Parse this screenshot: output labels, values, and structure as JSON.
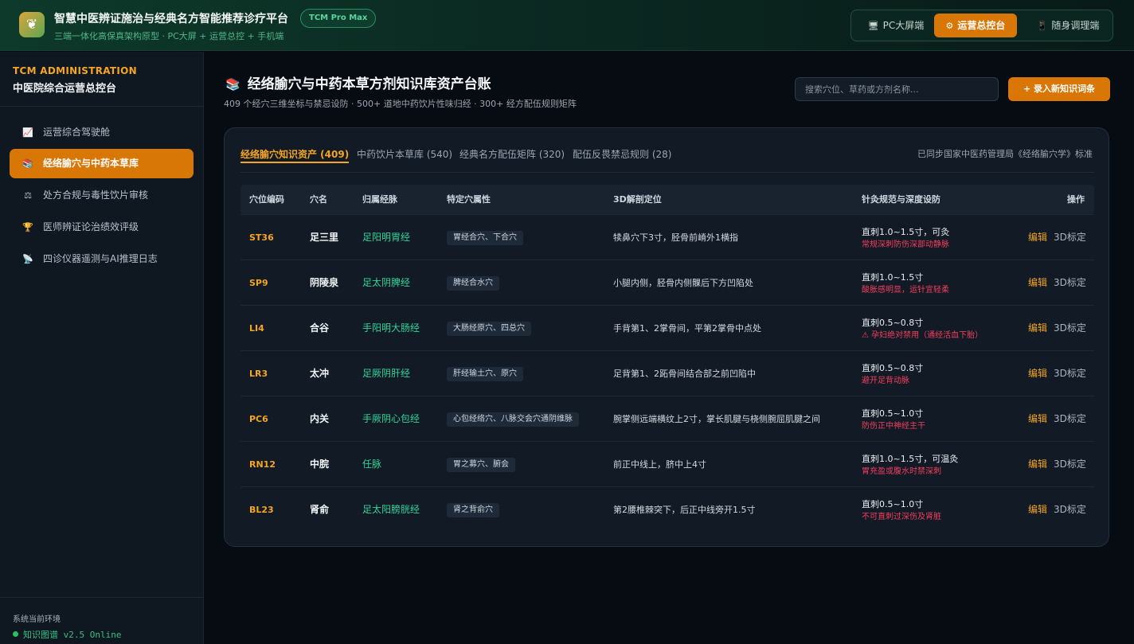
{
  "header": {
    "logo_icon": "leaf-icon",
    "title": "智慧中医辨证施治与经典名方智能推荐诊疗平台",
    "badge": "TCM Pro Max",
    "subtitle": "三端一体化高保真架构原型 · PC大屏 + 运营总控 + 手机端",
    "modes": [
      {
        "icon": "🖥",
        "label": "PC大屏端",
        "active": false
      },
      {
        "icon": "⚙",
        "label": "运营总控台",
        "active": true
      },
      {
        "icon": "📱",
        "label": "随身调理端",
        "active": false
      }
    ]
  },
  "sidebar": {
    "title_en": "TCM ADMINISTRATION",
    "title_cn": "中医院综合运营总控台",
    "items": [
      {
        "icon": "📈",
        "label": "运营综合驾驶舱",
        "active": false
      },
      {
        "icon": "📚",
        "label": "经络腧穴与中药本草库",
        "active": true
      },
      {
        "icon": "⚖",
        "label": "处方合规与毒性饮片审核",
        "active": false
      },
      {
        "icon": "🏆",
        "label": "医师辨证论治绩效评级",
        "active": false
      },
      {
        "icon": "📡",
        "label": "四诊仪器遥测与AI推理日志",
        "active": false
      }
    ],
    "env_label": "系统当前环境",
    "env_status": "知识图谱 v2.5 Online"
  },
  "main": {
    "title_icon": "📚",
    "title": "经络腧穴与中药本草方剂知识库资产台账",
    "subtitle": "409 个经穴三维坐标与禁忌设防 · 500+ 道地中药饮片性味归经 · 300+ 经方配伍规则矩阵",
    "search_placeholder": "搜索穴位、草药或方剂名称...",
    "add_button": "+ 录入新知识词条",
    "tabs": [
      {
        "label": "经络腧穴知识资产 (409)",
        "active": true
      },
      {
        "label": "中药饮片本草库 (540)",
        "active": false
      },
      {
        "label": "经典名方配伍矩阵 (320)",
        "active": false
      },
      {
        "label": "配伍反畏禁忌规则 (28)",
        "active": false
      }
    ],
    "sync_note": "已同步国家中医药管理局《经络腧穴学》标准",
    "columns": [
      "穴位编码",
      "穴名",
      "归属经脉",
      "特定穴属性",
      "3D解剖定位",
      "针灸规范与深度设防",
      "操作"
    ],
    "rows": [
      {
        "code": "ST36",
        "name": "足三里",
        "meridian": "足阳明胃经",
        "attr": "胃经合穴、下合穴",
        "location": "犊鼻穴下3寸，胫骨前嵴外1横指",
        "spec": "直刺1.0~1.5寸，可灸",
        "warning": "常规深刺防伤深部动静脉",
        "edit": "编辑",
        "calib": "3D标定"
      },
      {
        "code": "SP9",
        "name": "阴陵泉",
        "meridian": "足太阴脾经",
        "attr": "脾经合水穴",
        "location": "小腿内侧，胫骨内侧髁后下方凹陷处",
        "spec": "直刺1.0~1.5寸",
        "warning": "酸胀感明显，运针宜轻柔",
        "edit": "编辑",
        "calib": "3D标定"
      },
      {
        "code": "LI4",
        "name": "合谷",
        "meridian": "手阳明大肠经",
        "attr": "大肠经原穴、四总穴",
        "location": "手背第1、2掌骨间，平第2掌骨中点处",
        "spec": "直刺0.5~0.8寸",
        "warning": "⚠ 孕妇绝对禁用（通经活血下胎）",
        "edit": "编辑",
        "calib": "3D标定"
      },
      {
        "code": "LR3",
        "name": "太冲",
        "meridian": "足厥阴肝经",
        "attr": "肝经输土穴、原穴",
        "location": "足背第1、2跖骨间结合部之前凹陷中",
        "spec": "直刺0.5~0.8寸",
        "warning": "避开足背动脉",
        "edit": "编辑",
        "calib": "3D标定"
      },
      {
        "code": "PC6",
        "name": "内关",
        "meridian": "手厥阴心包经",
        "attr": "心包经络穴、八脉交会穴通阴维脉",
        "location": "腕掌侧远端横纹上2寸，掌长肌腱与桡侧腕屈肌腱之间",
        "spec": "直刺0.5~1.0寸",
        "warning": "防伤正中神经主干",
        "edit": "编辑",
        "calib": "3D标定"
      },
      {
        "code": "RN12",
        "name": "中脘",
        "meridian": "任脉",
        "attr": "胃之募穴、腑会",
        "location": "前正中线上，脐中上4寸",
        "spec": "直刺1.0~1.5寸，可温灸",
        "warning": "胃充盈或腹水时禁深刺",
        "edit": "编辑",
        "calib": "3D标定"
      },
      {
        "code": "BL23",
        "name": "肾俞",
        "meridian": "足太阳膀胱经",
        "attr": "肾之背俞穴",
        "location": "第2腰椎棘突下，后正中线旁开1.5寸",
        "spec": "直刺0.5~1.0寸",
        "warning": "不可直刺过深伤及肾脏",
        "edit": "编辑",
        "calib": "3D标定"
      }
    ]
  }
}
